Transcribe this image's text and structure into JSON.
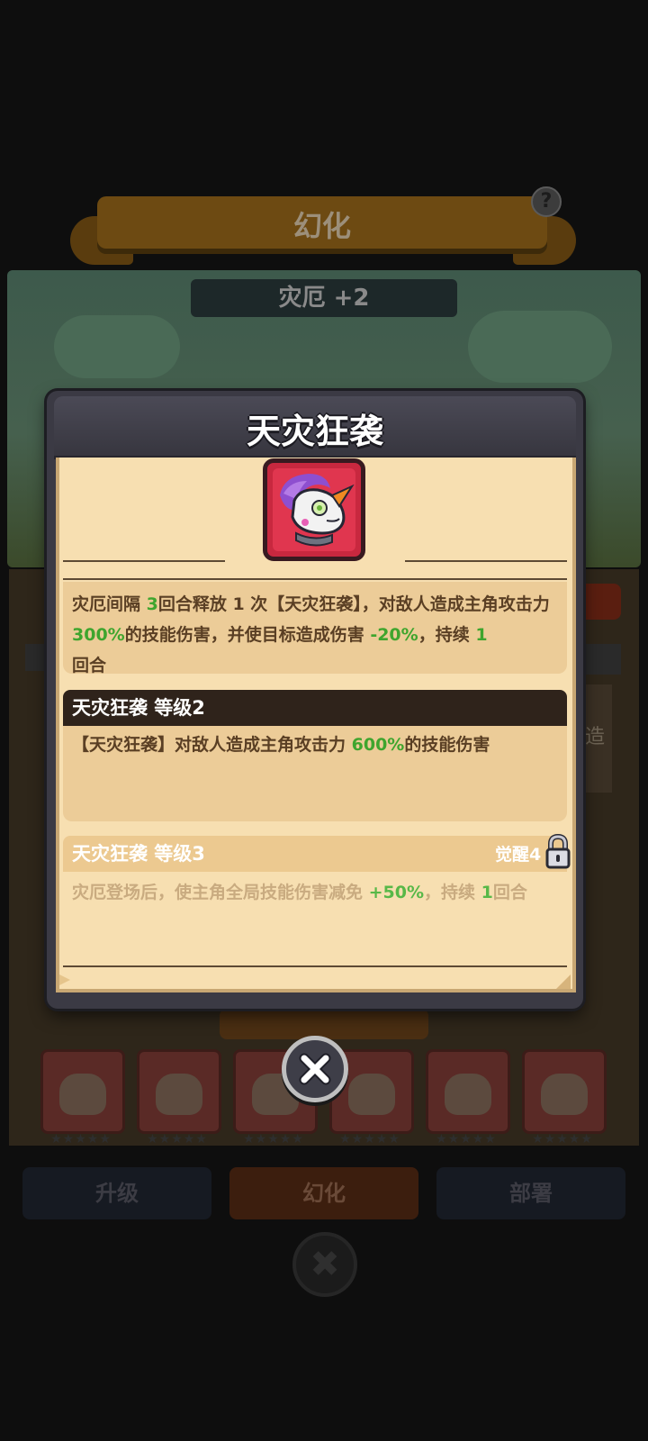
{
  "background": {
    "banner_title": "幻化",
    "help_icon": "?",
    "level_tag": "灾厄 +2",
    "side_text": "造",
    "tabs": [
      {
        "label": "升级"
      },
      {
        "label": "幻化"
      },
      {
        "label": "部署"
      }
    ],
    "close_icon": "✖",
    "card_stars": "★★★★★"
  },
  "modal": {
    "title": "天灾狂袭",
    "description": {
      "p1": "灾厄间隔 ",
      "v1": "3",
      "p2": "回合释放 1 次【天灾狂袭】，对敌人造成主角攻击力 ",
      "v2": "300%",
      "p3": "的技能伤害，并使目标造成伤害 ",
      "v3": "-20%",
      "p4": "，持续 ",
      "v4": "1",
      "p5": "回合"
    },
    "level2": {
      "title": "天灾狂袭 等级2",
      "t1": "【天灾狂袭】对敌人造成主角攻击力 ",
      "v1": "600%",
      "t2": "的技能伤害"
    },
    "level3": {
      "title": "天灾狂袭 等级3",
      "lock_label": "觉醒4",
      "t1": "灾厄登场后，使主角全局技能伤害减免 ",
      "v1": "+50%",
      "t2": "，持续 ",
      "v2": "1",
      "t3": "回合"
    }
  },
  "colors": {
    "accent_green": "#3fa52e",
    "panel_bg": "#f7dfb1",
    "header_dark": "#2f231b",
    "modal_frame": "#3b3a44"
  }
}
